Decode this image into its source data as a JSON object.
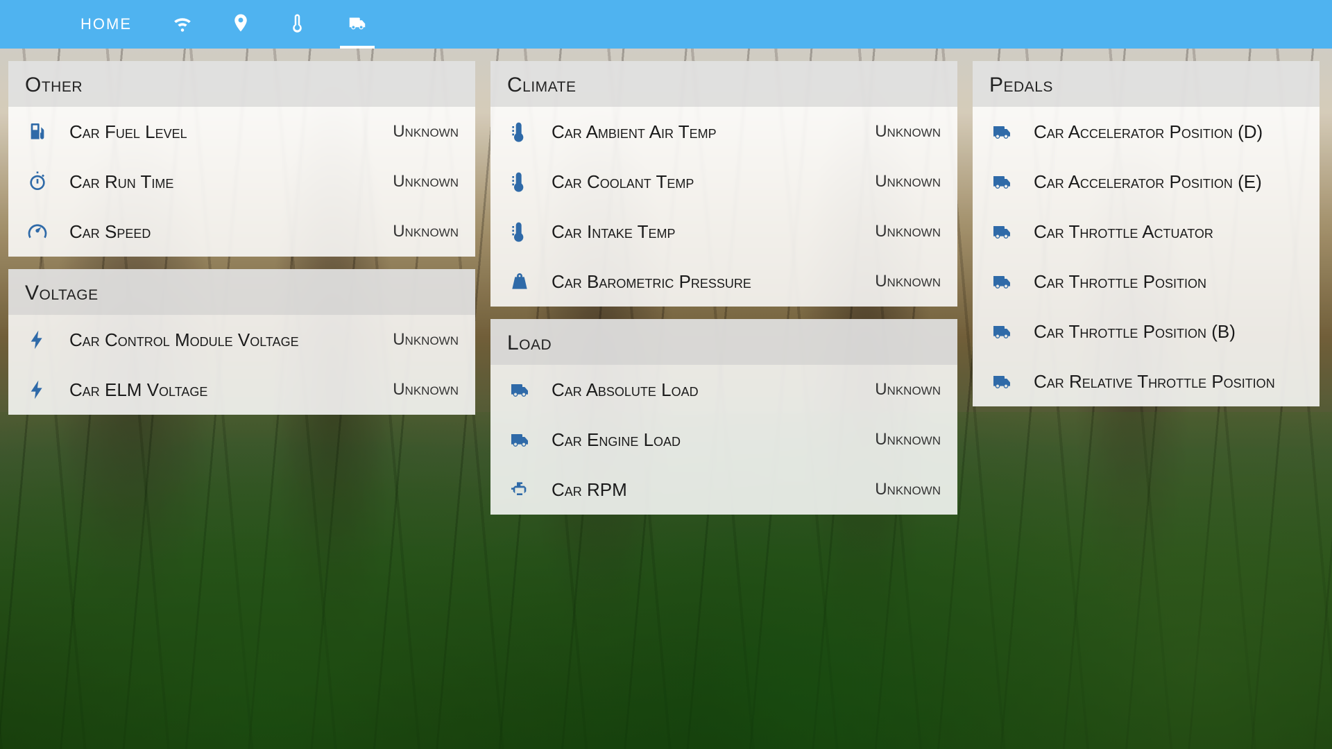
{
  "colors": {
    "accent": "#4fb3f0",
    "iconBlue": "#2f6aa8"
  },
  "topbar": {
    "tabs": [
      {
        "kind": "text",
        "label": "HOME",
        "icon": null,
        "active": false
      },
      {
        "kind": "icon",
        "label": "",
        "icon": "wifi-icon",
        "active": false
      },
      {
        "kind": "icon",
        "label": "",
        "icon": "location-icon",
        "active": false
      },
      {
        "kind": "icon",
        "label": "",
        "icon": "thermometer-icon",
        "active": false
      },
      {
        "kind": "icon",
        "label": "",
        "icon": "van-icon",
        "active": true
      }
    ]
  },
  "columns": [
    {
      "cards": [
        {
          "title": "Other",
          "rows": [
            {
              "icon": "fuel-icon",
              "label": "Car Fuel Level",
              "value": "Unknown"
            },
            {
              "icon": "stopwatch-icon",
              "label": "Car Run Time",
              "value": "Unknown"
            },
            {
              "icon": "gauge-icon",
              "label": "Car Speed",
              "value": "Unknown"
            }
          ]
        },
        {
          "title": "Voltage",
          "rows": [
            {
              "icon": "bolt-icon",
              "label": "Car Control Module Voltage",
              "value": "Unknown"
            },
            {
              "icon": "bolt-icon",
              "label": "Car ELM Voltage",
              "value": "Unknown"
            }
          ]
        }
      ]
    },
    {
      "cards": [
        {
          "title": "Climate",
          "rows": [
            {
              "icon": "temp-icon",
              "label": "Car Ambient Air Temp",
              "value": "Unknown"
            },
            {
              "icon": "temp-icon",
              "label": "Car Coolant Temp",
              "value": "Unknown"
            },
            {
              "icon": "temp-icon",
              "label": "Car Intake Temp",
              "value": "Unknown"
            },
            {
              "icon": "weight-icon",
              "label": "Car Barometric Pressure",
              "value": "Unknown"
            }
          ]
        },
        {
          "title": "Load",
          "rows": [
            {
              "icon": "van-icon",
              "label": "Car Absolute Load",
              "value": "Unknown"
            },
            {
              "icon": "van-icon",
              "label": "Car Engine Load",
              "value": "Unknown"
            },
            {
              "icon": "engine-icon",
              "label": "Car RPM",
              "value": "Unknown"
            }
          ]
        }
      ]
    },
    {
      "narrow": true,
      "cards": [
        {
          "title": "Pedals",
          "rows": [
            {
              "icon": "van-icon",
              "label": "Car Accelerator Position (D)",
              "value": ""
            },
            {
              "icon": "van-icon",
              "label": "Car Accelerator Position (E)",
              "value": ""
            },
            {
              "icon": "van-icon",
              "label": "Car Throttle Actuator",
              "value": ""
            },
            {
              "icon": "van-icon",
              "label": "Car Throttle Position",
              "value": ""
            },
            {
              "icon": "van-icon",
              "label": "Car Throttle Position (B)",
              "value": ""
            },
            {
              "icon": "van-icon",
              "label": "Car Relative Throttle Position",
              "value": ""
            }
          ]
        }
      ]
    }
  ]
}
